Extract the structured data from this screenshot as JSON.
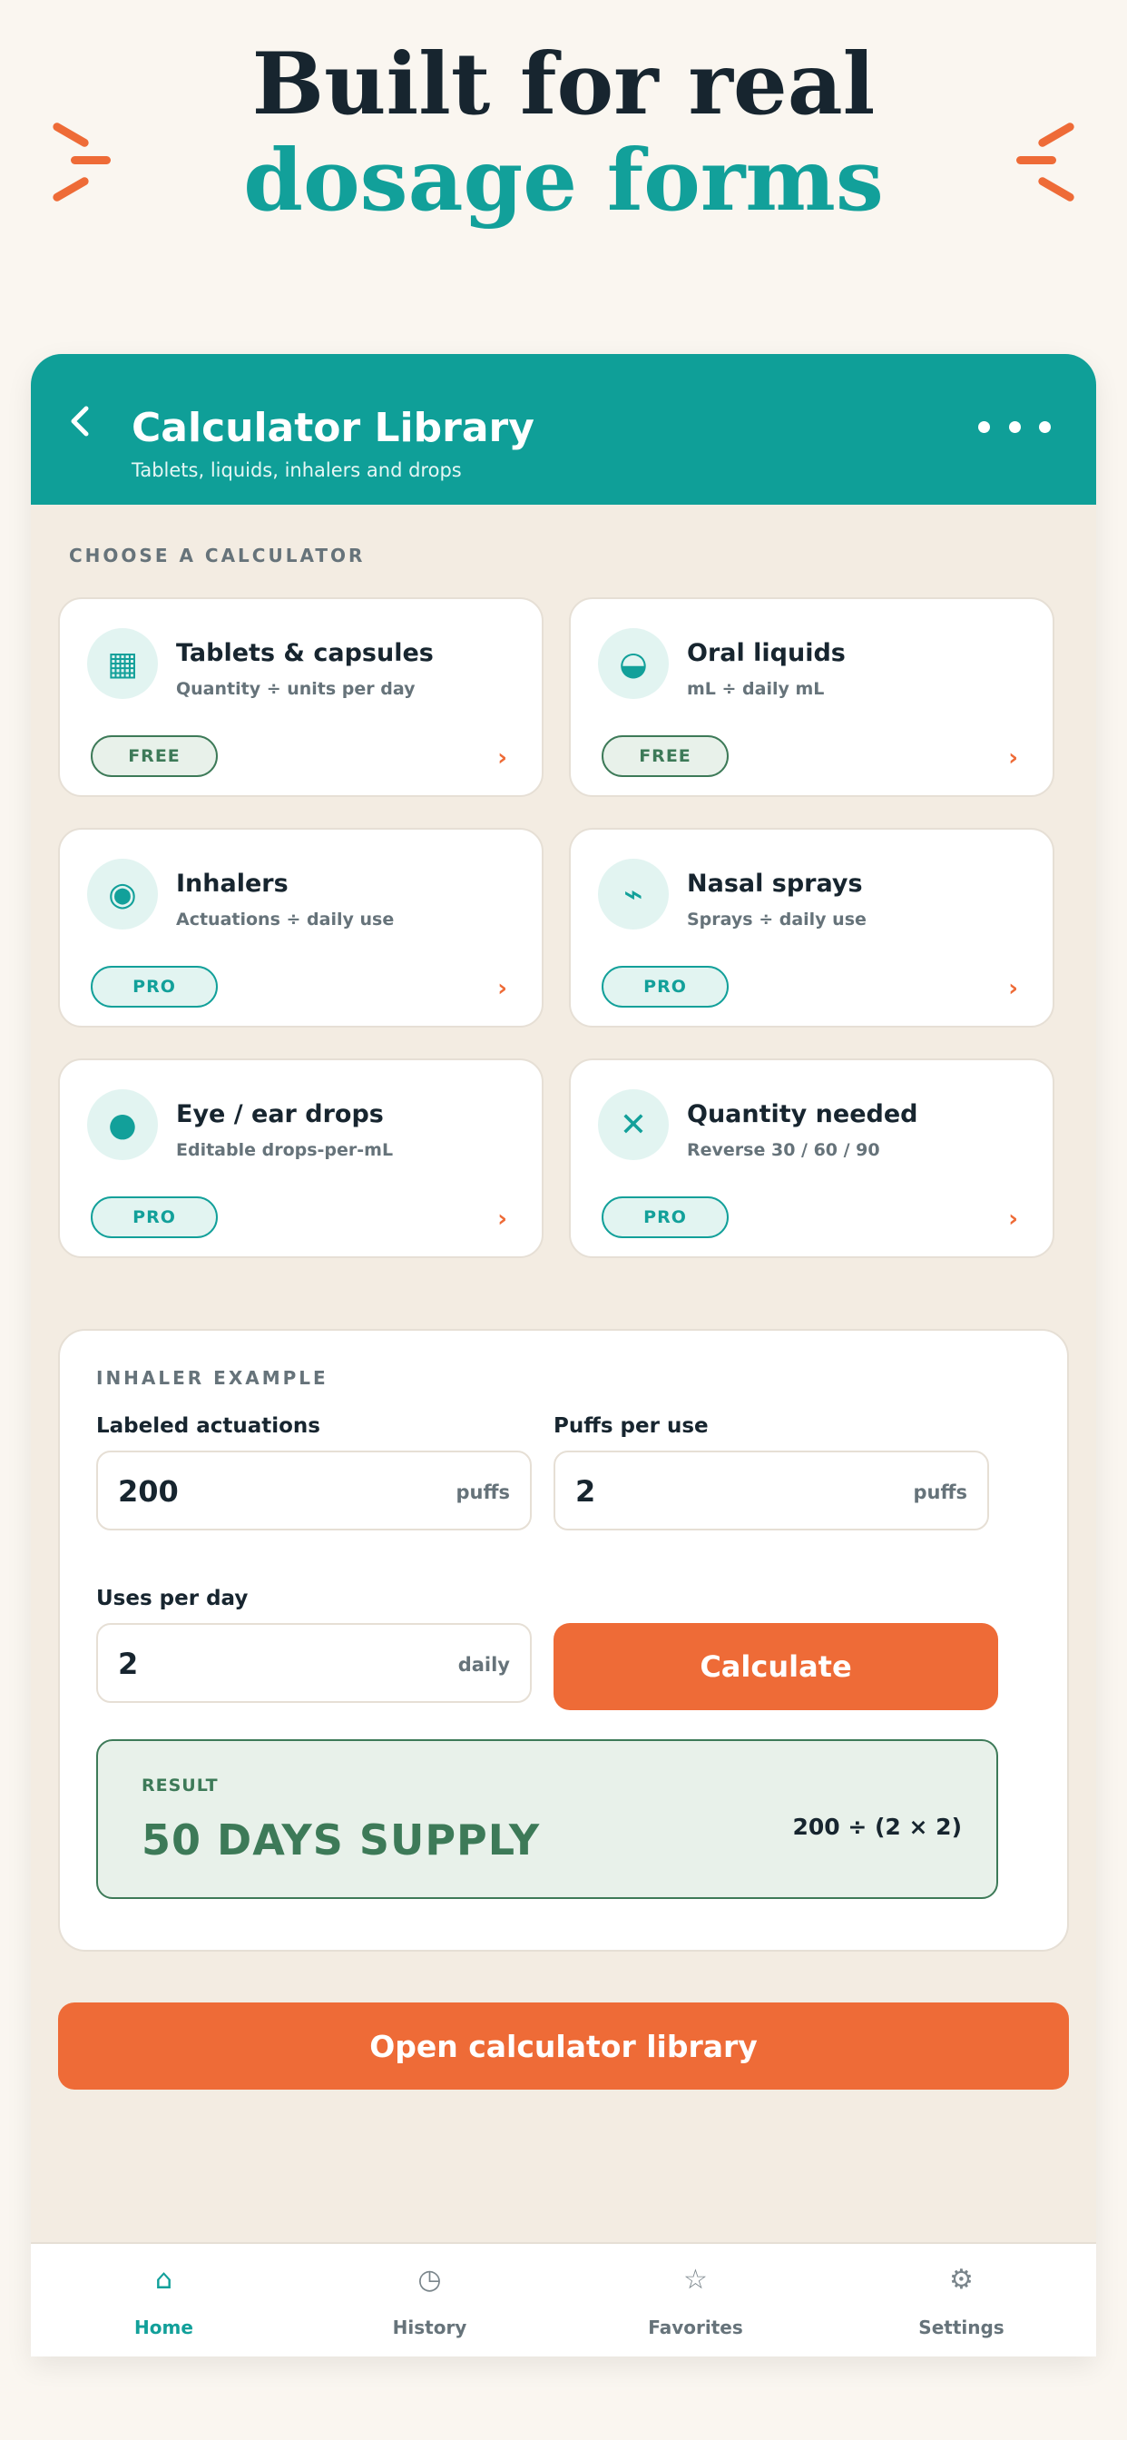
{
  "hero": {
    "line1": "Built for real",
    "line2": "dosage forms"
  },
  "header": {
    "title": "Calculator Library",
    "subtitle": "Tablets, liquids, inhalers and drops",
    "back_icon": "chevron-left-icon",
    "more_icon": "more-dots-icon"
  },
  "section_label": "CHOOSE A CALCULATOR",
  "calculators": [
    {
      "title": "Tablets & capsules",
      "subtitle": "Quantity ÷ units per day",
      "badge": "FREE",
      "icon": "grid-icon",
      "glyph": "▦"
    },
    {
      "title": "Oral liquids",
      "subtitle": "mL ÷ daily mL",
      "badge": "FREE",
      "icon": "half-circle-icon",
      "glyph": "◒"
    },
    {
      "title": "Inhalers",
      "subtitle": "Actuations ÷ daily use",
      "badge": "PRO",
      "icon": "target-icon",
      "glyph": "◉"
    },
    {
      "title": "Nasal sprays",
      "subtitle": "Sprays ÷ daily use",
      "badge": "PRO",
      "icon": "spray-icon",
      "glyph": "⌁"
    },
    {
      "title": "Eye / ear drops",
      "subtitle": "Editable drops-per-mL",
      "badge": "PRO",
      "icon": "dot-icon",
      "glyph": "●"
    },
    {
      "title": "Quantity needed",
      "subtitle": "Reverse 30 / 60 / 90",
      "badge": "PRO",
      "icon": "x-icon",
      "glyph": "✕"
    }
  ],
  "example": {
    "label": "INHALER EXAMPLE",
    "fields": {
      "actuations": {
        "label": "Labeled actuations",
        "value": "200",
        "unit": "puffs"
      },
      "puffs": {
        "label": "Puffs per use",
        "value": "2",
        "unit": "puffs"
      },
      "uses": {
        "label": "Uses per day",
        "value": "2",
        "unit": "daily"
      }
    },
    "calculate_label": "Calculate",
    "result": {
      "label": "RESULT",
      "value": "50 DAYS SUPPLY",
      "formula": "200 ÷ (2 × 2)"
    }
  },
  "open_library_label": "Open calculator library",
  "nav": [
    {
      "label": "Home",
      "icon": "home-icon",
      "glyph": "⌂",
      "active": true
    },
    {
      "label": "History",
      "icon": "clock-icon",
      "glyph": "◷",
      "active": false
    },
    {
      "label": "Favorites",
      "icon": "star-icon",
      "glyph": "☆",
      "active": false
    },
    {
      "label": "Settings",
      "icon": "gear-icon",
      "glyph": "⚙",
      "active": false
    }
  ],
  "colors": {
    "teal": "#0f9f98",
    "orange": "#ee6b37",
    "green": "#3d7a58",
    "ink": "#17252f"
  }
}
